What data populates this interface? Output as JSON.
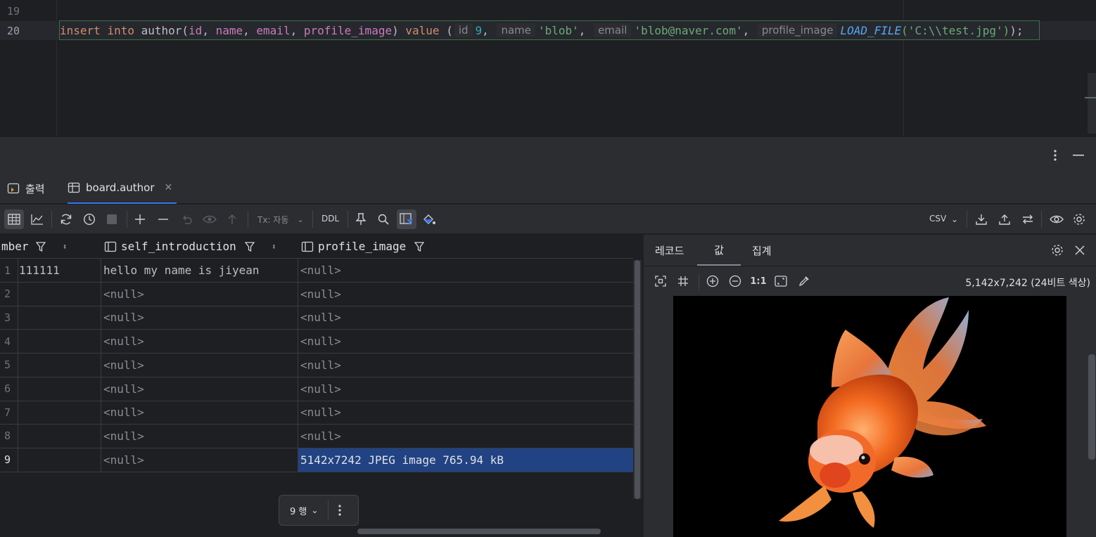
{
  "editor": {
    "line_numbers": [
      "19",
      "20"
    ],
    "sql": {
      "kw_insert": "insert",
      "kw_into": "into",
      "table": "author",
      "paren_open": "(",
      "col_id": "id",
      "col_name": "name",
      "col_email": "email",
      "col_profile_image": "profile_image",
      "paren_close": ")",
      "kw_value": "value",
      "values_open": "(",
      "hint_id": "id",
      "val_id": "9",
      "hint_name": "name",
      "val_name": "'blob'",
      "hint_email": "email",
      "val_email": "'blob@naver.com'",
      "hint_profile_image": "profile_image",
      "fn_load_file": "LOAD_FILE",
      "fn_arg": "('C:\\\\test.jpg')",
      "end": ");",
      "comma": ",",
      "space": " "
    }
  },
  "tabs": [
    {
      "label": "출력",
      "icon": "output-icon"
    },
    {
      "label": "board.author",
      "icon": "table-icon"
    }
  ],
  "toolbar": {
    "tx_label": "Tx: 자동",
    "ddl_label": "DDL",
    "export_format": "CSV"
  },
  "grid": {
    "columns": [
      {
        "label": "mber"
      },
      {
        "label": "self_introduction"
      },
      {
        "label": "profile_image"
      }
    ],
    "rows": [
      {
        "n": "1",
        "c1": "111111",
        "c2": "hello my name is jiyean",
        "c3": "<null>"
      },
      {
        "n": "2",
        "c1": "",
        "c2": "<null>",
        "c3": "<null>"
      },
      {
        "n": "3",
        "c1": "",
        "c2": "<null>",
        "c3": "<null>"
      },
      {
        "n": "4",
        "c1": "",
        "c2": "<null>",
        "c3": "<null>"
      },
      {
        "n": "5",
        "c1": "",
        "c2": "<null>",
        "c3": "<null>"
      },
      {
        "n": "6",
        "c1": "",
        "c2": "<null>",
        "c3": "<null>"
      },
      {
        "n": "7",
        "c1": "",
        "c2": "<null>",
        "c3": "<null>"
      },
      {
        "n": "8",
        "c1": "",
        "c2": "<null>",
        "c3": "<null>"
      },
      {
        "n": "9",
        "c1": "",
        "c2": "<null>",
        "c3": "5142x7242 JPEG image 765.94 kB"
      }
    ],
    "pager_label": "9 행"
  },
  "panel": {
    "tabs": [
      "레코드",
      "값",
      "집계"
    ],
    "zoom_reset": "1:1",
    "image_meta": "5,142x7,242 (24비트 색상)"
  },
  "colors": {
    "accent": "#3574f0",
    "selection": "#214283"
  }
}
